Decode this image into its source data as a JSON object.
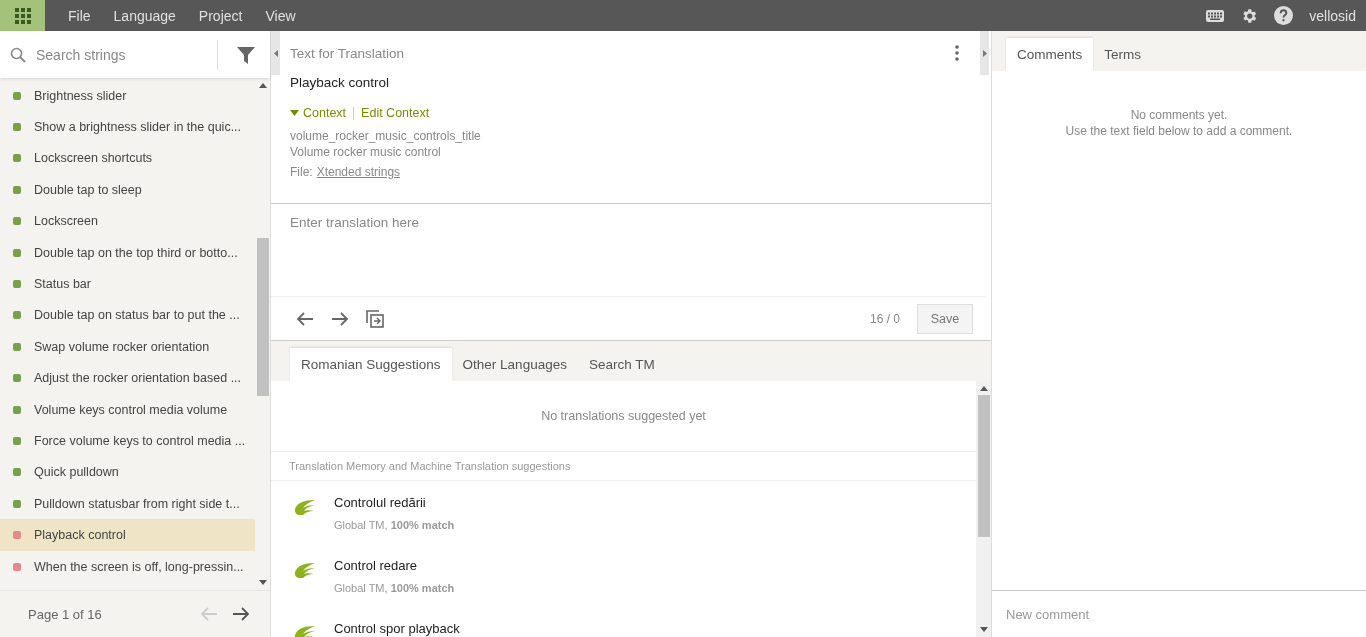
{
  "menu": {
    "items": [
      "File",
      "Language",
      "Project",
      "View"
    ],
    "user": "vellosid"
  },
  "sidebar": {
    "search": {
      "placeholder": "Search strings"
    },
    "strings": [
      {
        "text": "Brightness slider",
        "color": "#76a34a",
        "selected": false
      },
      {
        "text": "Show a brightness slider in the quic...",
        "color": "#76a34a",
        "selected": false
      },
      {
        "text": "Lockscreen shortcuts",
        "color": "#76a34a",
        "selected": false
      },
      {
        "text": "Double tap to sleep",
        "color": "#76a34a",
        "selected": false
      },
      {
        "text": "Lockscreen",
        "color": "#76a34a",
        "selected": false
      },
      {
        "text": "Double tap on the top third or botto...",
        "color": "#76a34a",
        "selected": false
      },
      {
        "text": "Status bar",
        "color": "#76a34a",
        "selected": false
      },
      {
        "text": "Double tap on status bar to put the ...",
        "color": "#76a34a",
        "selected": false
      },
      {
        "text": "Swap volume rocker orientation",
        "color": "#76a34a",
        "selected": false
      },
      {
        "text": "Adjust the rocker orientation based ...",
        "color": "#76a34a",
        "selected": false
      },
      {
        "text": "Volume keys control media volume",
        "color": "#76a34a",
        "selected": false
      },
      {
        "text": "Force volume keys to control media ...",
        "color": "#76a34a",
        "selected": false
      },
      {
        "text": "Quick pulldown",
        "color": "#76a34a",
        "selected": false
      },
      {
        "text": "Pulldown statusbar from right side t...",
        "color": "#76a34a",
        "selected": false
      },
      {
        "text": "Playback control",
        "color": "#e5898b",
        "selected": true
      },
      {
        "text": "When the screen is off, long-pressin...",
        "color": "#e5898b",
        "selected": false
      }
    ],
    "pager": "Page 1 of 16"
  },
  "source": {
    "heading": "Text for Translation",
    "text": "Playback control",
    "context_toggle": "Context",
    "context_expanded": true,
    "edit_context": "Edit Context",
    "key": "volume_rocker_music_controls_title",
    "description": "Volume rocker music control",
    "file_label": "File:",
    "file_link": "Xtended strings"
  },
  "translation": {
    "placeholder": "Enter translation here",
    "counter": "16 / 0",
    "save": "Save"
  },
  "suggestion_tabs": [
    {
      "label": "Romanian Suggestions",
      "selected": true
    },
    {
      "label": "Other Languages",
      "selected": false
    },
    {
      "label": "Search TM",
      "selected": false
    }
  ],
  "suggestions": {
    "empty": "No translations suggested yet",
    "heading": "Translation Memory and Machine Translation suggestions",
    "items": [
      {
        "text": "Controlul redării",
        "meta": "Global TM, **100% match**"
      },
      {
        "text": "Control redare",
        "meta": "Global TM, **100% match**"
      },
      {
        "text": "Control spor playback"
      }
    ]
  },
  "side_tabs": [
    {
      "label": "Comments",
      "selected": true
    },
    {
      "label": "Terms",
      "selected": false
    }
  ],
  "comments": {
    "empty": [
      "No comments yet.",
      "Use the text field below to add a comment."
    ],
    "placeholder": "New comment"
  }
}
